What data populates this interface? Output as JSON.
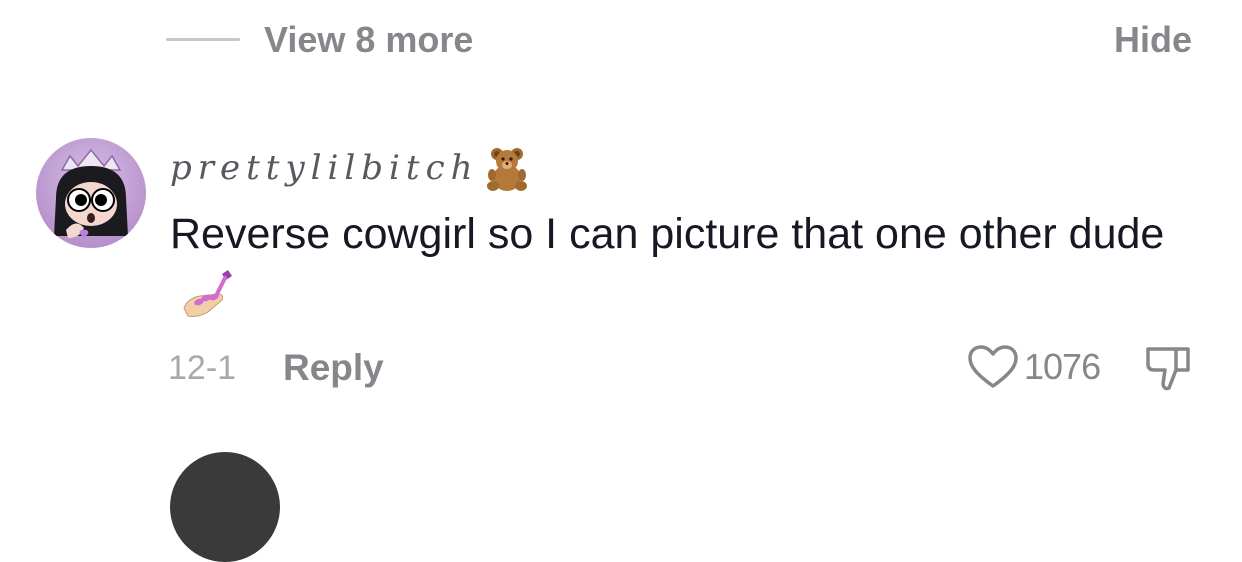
{
  "replies": {
    "view_more_label": "View 8 more",
    "hide_label": "Hide"
  },
  "comment": {
    "username": "prettylilbitch",
    "username_icon": "teddy-bear-emoji",
    "text": "Reverse cowgirl so I can picture that one other dude",
    "text_icon": "nail-polish-emoji",
    "date": "12-1",
    "reply_label": "Reply",
    "like_count": "1076"
  },
  "colors": {
    "muted": "#86878b",
    "text": "#161823",
    "divider": "#c6c6ca",
    "avatar_purple": "#c8a6d8"
  }
}
